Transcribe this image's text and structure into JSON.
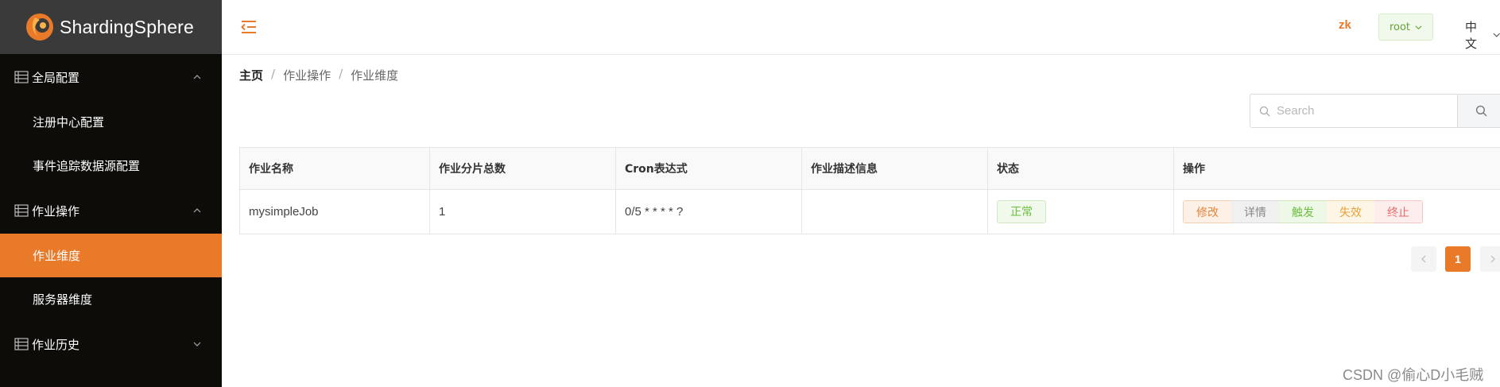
{
  "app": {
    "logo_text": "ShardingSphere"
  },
  "sidebar": {
    "groups": [
      {
        "label": "全局配置",
        "expanded": true,
        "items": [
          "注册中心配置",
          "事件追踪数据源配置"
        ]
      },
      {
        "label": "作业操作",
        "expanded": true,
        "items": [
          "作业维度",
          "服务器维度"
        ]
      },
      {
        "label": "作业历史",
        "expanded": false,
        "items": []
      }
    ],
    "active_item": "作业维度"
  },
  "header": {
    "zk_label": "zk",
    "user_label": "root",
    "language_label": "中文"
  },
  "breadcrumb": {
    "home": "主页",
    "level1": "作业操作",
    "level2": "作业维度",
    "separator": "/"
  },
  "search": {
    "placeholder": "Search",
    "value": ""
  },
  "table": {
    "columns": [
      "作业名称",
      "作业分片总数",
      "Cron表达式",
      "作业描述信息",
      "状态",
      "操作"
    ],
    "rows": [
      {
        "name": "mysimpleJob",
        "sharding_total": "1",
        "cron": "0/5 * * * * ?",
        "description": "",
        "status": "正常",
        "actions": [
          "修改",
          "详情",
          "触发",
          "失效",
          "终止"
        ]
      }
    ]
  },
  "pagination": {
    "current_page": "1"
  },
  "watermark": "CSDN @偷心D小毛贼",
  "colors": {
    "accent": "#e87a2a",
    "sidebar_bg": "#0d0c08",
    "logo_bg": "#3a3a3a",
    "success": "#6abf40",
    "warning": "#e6a23c",
    "danger": "#e96a6a"
  }
}
